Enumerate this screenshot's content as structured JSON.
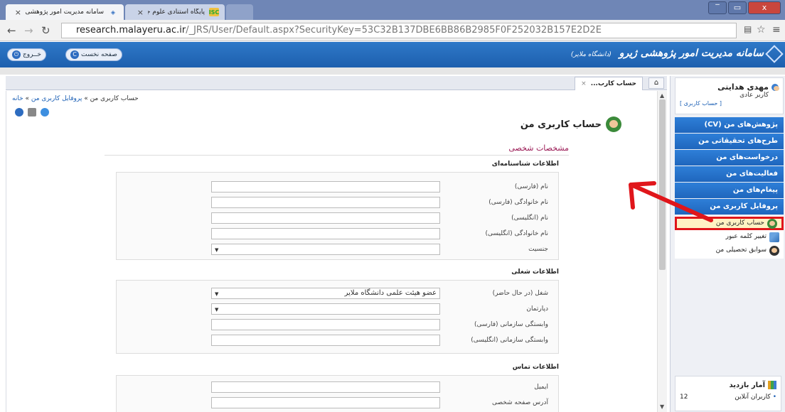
{
  "browser": {
    "tabs": [
      {
        "title": "سامانه مدیریت امور پژوهشی ژیرو",
        "active": true
      },
      {
        "title": "پایگاه استنادی علوم جهان اسلام",
        "active": false,
        "favicon_text": "ISC"
      }
    ],
    "url_host": "research.malayeru.ac.ir",
    "url_path": "/_JRS/User/Default.aspx?SecurityKey=53C32B137DBE6BB86B2985F0F252032B157E2D2E",
    "window_buttons": [
      "‾",
      "▭",
      "x"
    ]
  },
  "header": {
    "app_title": "سامانه مدیریت امور پژوهشی ژیرو",
    "app_subtitle": "(دانشگاه ملایر)",
    "home_button": "صفحه نخست",
    "logout_button": "خــروج"
  },
  "sidebar": {
    "user_name": "مهدی هدایتی",
    "user_role": "کاربر عادی",
    "user_link": "[ حساب کاربری ]",
    "menu": [
      "پژوهش‌های من (CV)",
      "طرح‌های تحقیقاتی من",
      "درخواست‌های من",
      "فعالیت‌های من",
      "پیغام‌های من",
      "پروفایل کاربری من"
    ],
    "submenu": [
      "حساب کاربری من",
      "تغییر کلمه عبور",
      "سوابق تحصیلی من"
    ],
    "stats_title": "آمار بازدید",
    "online_label": "کاربران آنلاین",
    "online_count": "12"
  },
  "content_tab": {
    "title": "حساب کارب...",
    "home_icon": "⌂"
  },
  "main": {
    "breadcrumb_home": "خانه",
    "breadcrumb_profile": "پروفایل کاربری من",
    "breadcrumb_current": "حساب کاربری من",
    "breadcrumb_sep": " » ",
    "page_title": "حساب کاربری من",
    "section_title": "مشخصات شخصی",
    "groups": {
      "identity": "اطلاعات شناسنامه‌ای",
      "job": "اطلاعات شغلی",
      "contact": "اطلاعات تماس"
    },
    "fields": {
      "name_fa": "نام (فارسی)",
      "family_fa": "نام خانوادگی (فارسی)",
      "name_en": "نام (انگلیسی)",
      "family_en": "نام خانوادگی (انگلیسی)",
      "gender": "جنسیت",
      "job_current": "شغل (در حال حاضر)",
      "job_current_value": "عضو هیئت علمی دانشگاه ملایر",
      "department": "دپارتمان",
      "affiliation_fa": "وابستگی سازمانی (فارسی)",
      "affiliation_en": "وابستگی سازمانی (انگلیسی)",
      "email": "ایمیل",
      "homepage": "آدرس صفحه شخصی"
    }
  },
  "colors": {
    "header_blue": "#1f66bd",
    "annotation_red": "#e0161b",
    "section_title": "#9b1b56"
  }
}
